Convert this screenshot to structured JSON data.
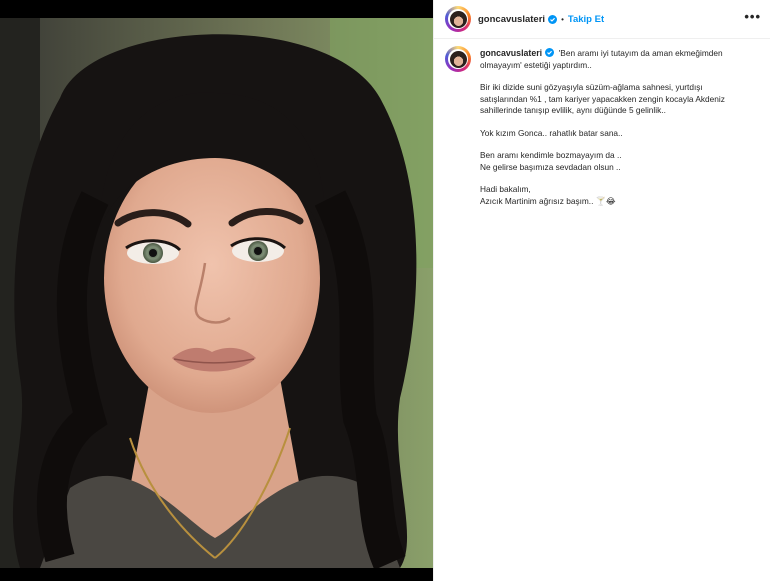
{
  "post": {
    "username": "goncavuslateri",
    "follow_label": "Takip Et",
    "separator": "•",
    "more_label": "•••",
    "caption_lines": [
      "'Ben aramı iyi tutayım da aman ekmeğimden",
      "olmayayım' estetiği yaptırdım..",
      "",
      "Bir iki dizide suni gözyaşıyla süzüm-ağlama sahnesi, yurtdışı",
      "satışlarından %1 , tam kariyer yapacakken zengin kocayla Akdeniz",
      "sahillerinde tanışıp evlilik, aynı düğünde 5 gelinlik..",
      "",
      "Yok kızım Gonca.. rahatlık batar sana..",
      "",
      "Ben aramı kendimle bozmayayım da ..",
      "Ne gelirse başımıza sevdadan olsun ..",
      "",
      "Hadi bakalım,",
      "Azıcık Martinim ağrısız başım.. 🍸😂"
    ]
  },
  "icons": {
    "verified": "verified-badge-icon",
    "more": "more-options-icon"
  },
  "colors": {
    "accent": "#0095f6",
    "text": "#262626",
    "border": "#efefef"
  }
}
